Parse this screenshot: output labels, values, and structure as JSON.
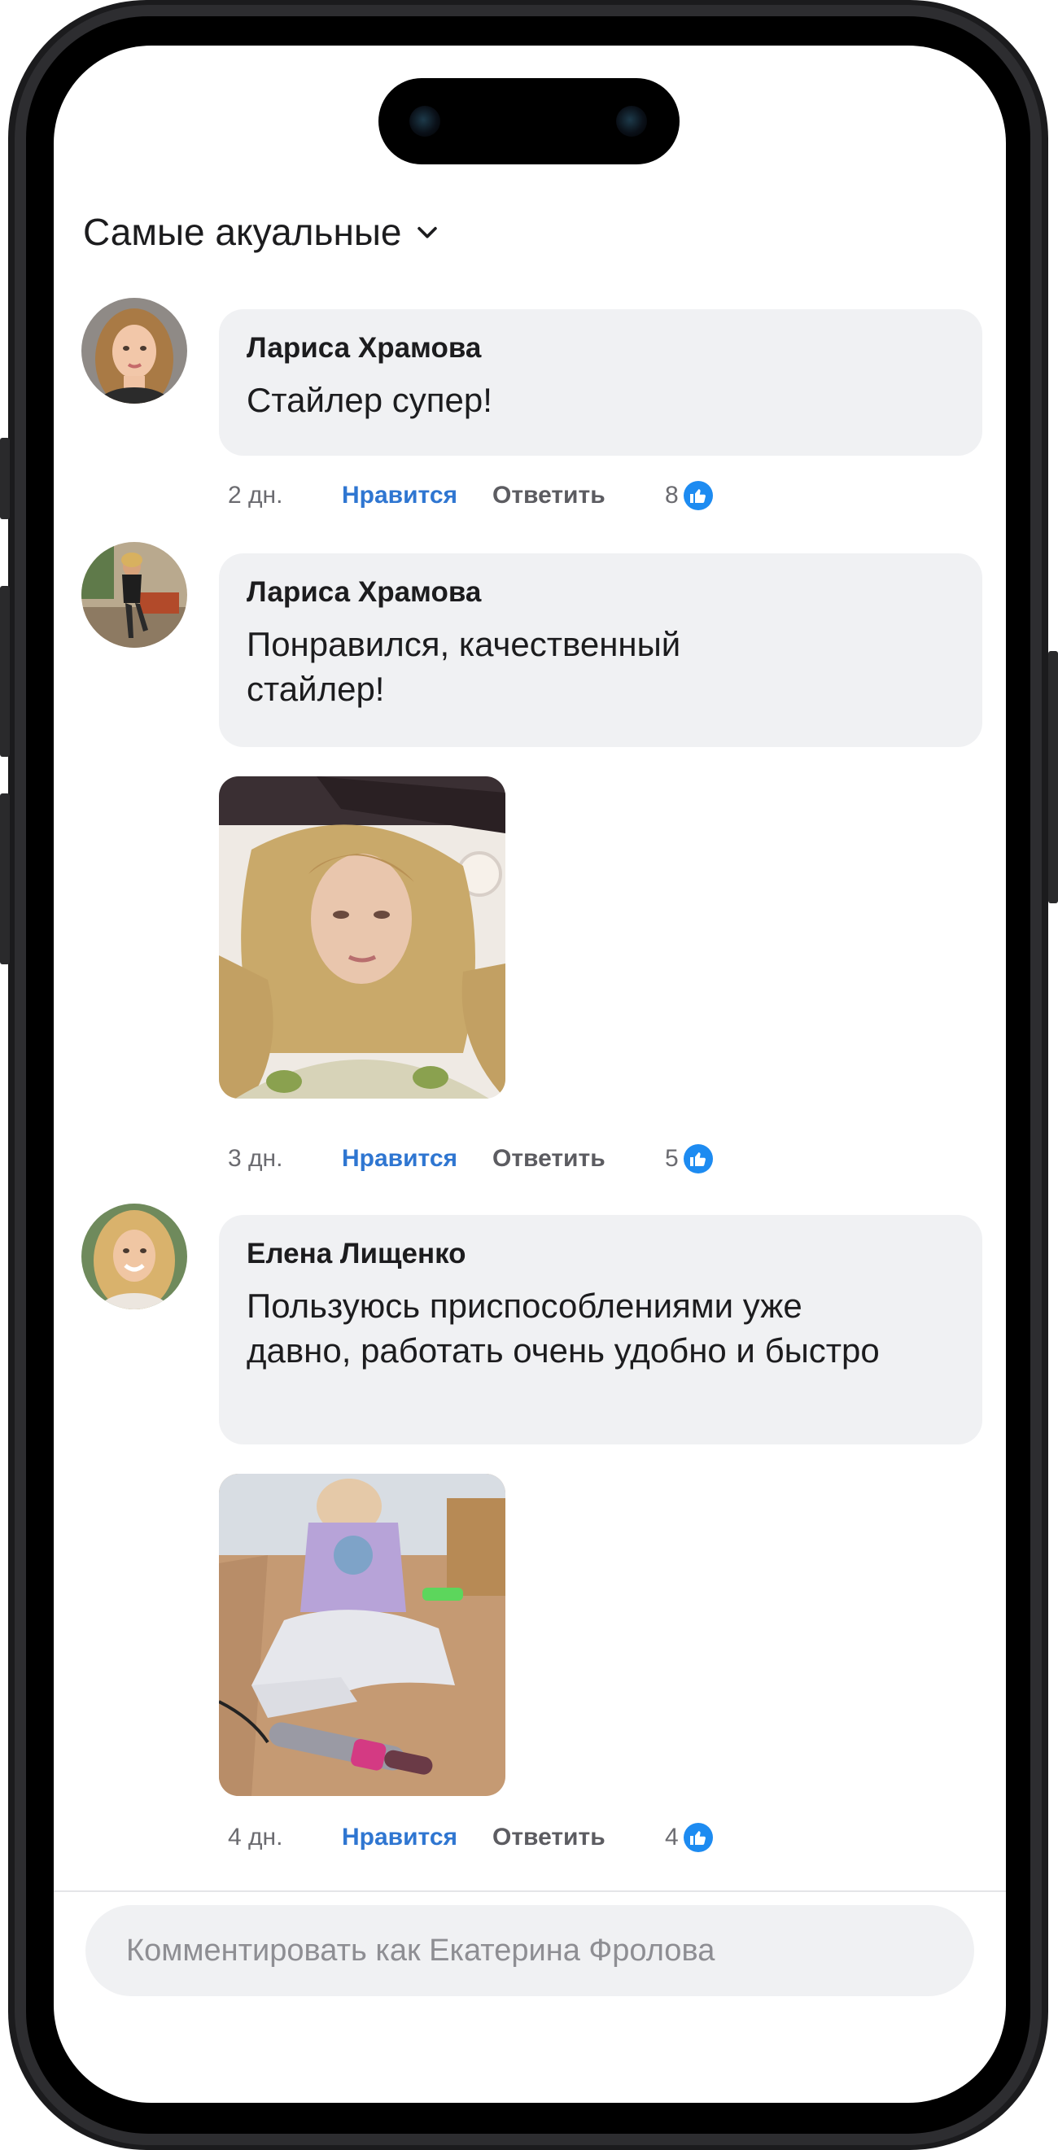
{
  "sort": {
    "label": "Самые акуальные"
  },
  "comments": [
    {
      "author": "Лариса Храмова",
      "text": "Стайлер супер!",
      "time": "2 дн.",
      "like_label": "Нравится",
      "reply_label": "Ответить",
      "likes": "8",
      "has_photo": false
    },
    {
      "author": "Лариса Храмова",
      "text": "Понравился, качественный стайлер!",
      "time": "3 дн.",
      "like_label": "Нравится",
      "reply_label": "Ответить",
      "likes": "5",
      "has_photo": true
    },
    {
      "author": "Елена Лищенко",
      "text": "Пользуюсь приспособлениями уже давно, работать очень удобно и быстро",
      "time": "4 дн.",
      "like_label": "Нравится",
      "reply_label": "Ответить",
      "likes": "4",
      "has_photo": true
    }
  ],
  "composer": {
    "placeholder": "Комментировать как Екатерина Фролова"
  },
  "colors": {
    "accent": "#2f76d1",
    "like_icon": "#1d8bf1",
    "bubble": "#f0f1f3"
  }
}
